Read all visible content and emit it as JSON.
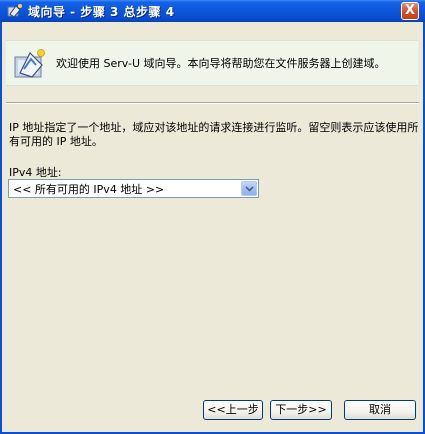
{
  "window": {
    "title": "域向导 - 步骤 3 总步骤 4",
    "close_label": "X"
  },
  "header": {
    "welcome": "欢迎使用 Serv-U 域向导。本向导将帮助您在文件服务器上创建域。"
  },
  "body": {
    "description": "IP 地址指定了一个地址，域应对该地址的请求连接进行监听。留空则表示应该使用所有可用的 IP 地址。",
    "ipv4_label": "IPv4 地址:",
    "ipv4_value": "<< 所有可用的 IPv4 地址 >>"
  },
  "buttons": {
    "back": "<<上一步",
    "next": "下一步>>",
    "cancel": "取消"
  },
  "colors": {
    "titlebar": "#0b56da",
    "dialog_bg": "#ece9d8",
    "header_band": "#f0f5ea",
    "close_button": "#d7512e"
  }
}
